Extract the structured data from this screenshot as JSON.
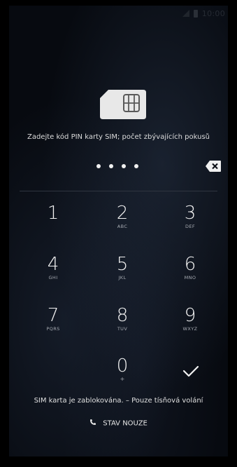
{
  "status_bar": {
    "time": "10:00",
    "icons": [
      "signal-icon",
      "battery-icon"
    ]
  },
  "sim_icon": "sim-card-icon",
  "prompt": "Zadejte kód PIN karty SIM; počet zbývajících pokusů",
  "pin": {
    "entered_digits": 4
  },
  "keypad": {
    "keys": [
      {
        "digit": "1",
        "letters": ""
      },
      {
        "digit": "2",
        "letters": "ABC"
      },
      {
        "digit": "3",
        "letters": "DEF"
      },
      {
        "digit": "4",
        "letters": "GHI"
      },
      {
        "digit": "5",
        "letters": "JKL"
      },
      {
        "digit": "6",
        "letters": "MNO"
      },
      {
        "digit": "7",
        "letters": "PQRS"
      },
      {
        "digit": "8",
        "letters": "TUV"
      },
      {
        "digit": "9",
        "letters": "WXYZ"
      },
      {
        "digit": "0",
        "letters": "+"
      }
    ],
    "enter_icon": "checkmark-icon",
    "backspace_icon": "backspace-icon"
  },
  "sim_locked_message": "SIM karta je zablokována. – Pouze tísňová volání",
  "emergency_button": {
    "label": "STAV NOUZE",
    "icon": "phone-icon"
  },
  "colors": {
    "background": "#000000",
    "text": "#f2f2f2",
    "secondary_text": "#a8acb3"
  }
}
